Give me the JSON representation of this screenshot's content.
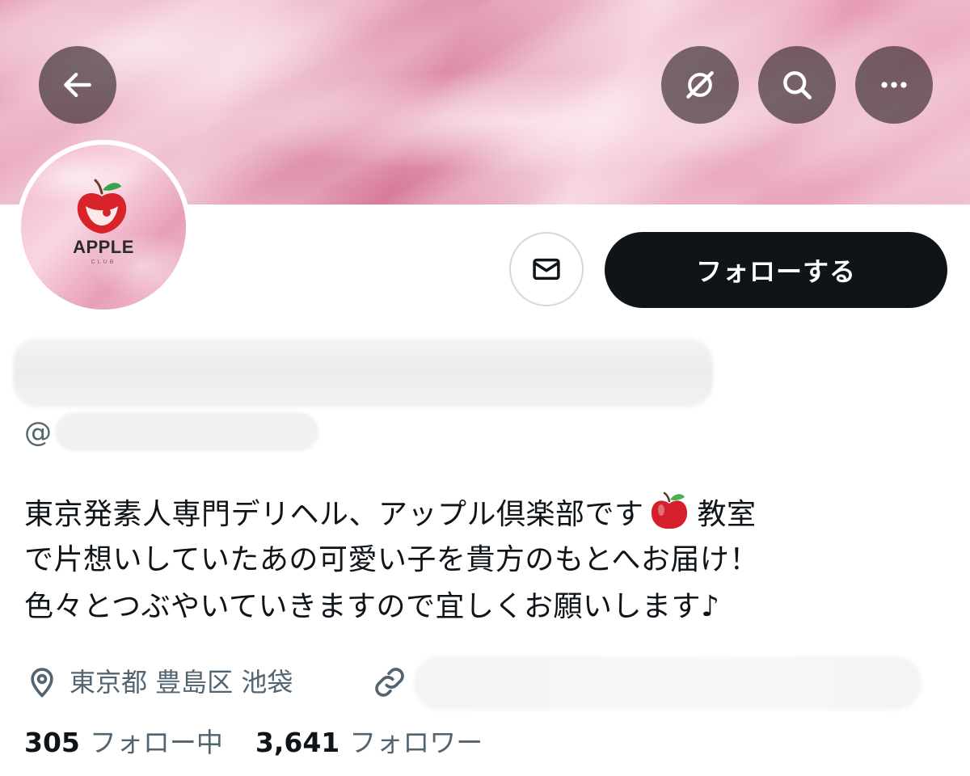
{
  "header": {
    "back_icon": "arrow-left-icon",
    "grok_icon": "grok-slash-icon",
    "search_icon": "search-icon",
    "more_icon": "more-dots-icon"
  },
  "avatar": {
    "brand_name": "APPLE",
    "brand_sub": "CLUB"
  },
  "actions": {
    "message_icon": "envelope-icon",
    "follow_label": "フォローする"
  },
  "profile": {
    "handle_prefix": "@",
    "bio_lines": [
      "東京発素人専門デリヘル、アップル倶楽部です",
      "教室",
      "で片想いしていたあの可愛い子を貴方のもとへお届け！",
      "色々とつぶやいていきますので宜しくお願いします♪"
    ],
    "location": "東京都 豊島区 池袋",
    "location_icon": "location-pin-icon",
    "link_icon": "link-icon"
  },
  "stats": {
    "following_count": "305",
    "following_label": "フォロー中",
    "followers_count": "3,641",
    "followers_label": "フォロワー"
  },
  "colors": {
    "button_dark": "#0f1419",
    "secondary_text": "#536471",
    "banner_pink": "#e9a3bb"
  }
}
